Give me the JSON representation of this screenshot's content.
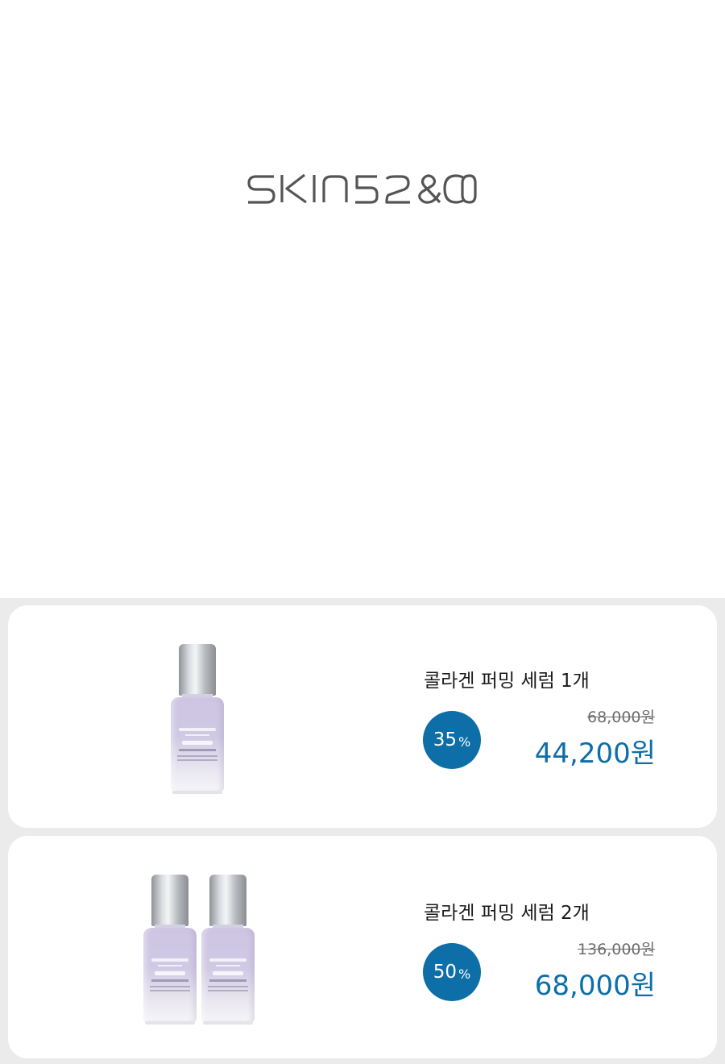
{
  "brand": {
    "logo_text": "SKIN52&CO",
    "logo_color": "#555555"
  },
  "colors": {
    "accent": "#0d6ea8",
    "list_background": "#ebebeb",
    "card_background": "#ffffff"
  },
  "products": [
    {
      "name": "콜라겐 퍼밍 세럼 1개",
      "discount_value": "35",
      "discount_unit": "%",
      "original_price": "68,000원",
      "sale_price": "44,200원",
      "image": "serum-bottle-single"
    },
    {
      "name": "콜라겐 퍼밍 세럼 2개",
      "discount_value": "50",
      "discount_unit": "%",
      "original_price": "136,000원",
      "sale_price": "68,000원",
      "image": "serum-bottle-pair"
    }
  ]
}
